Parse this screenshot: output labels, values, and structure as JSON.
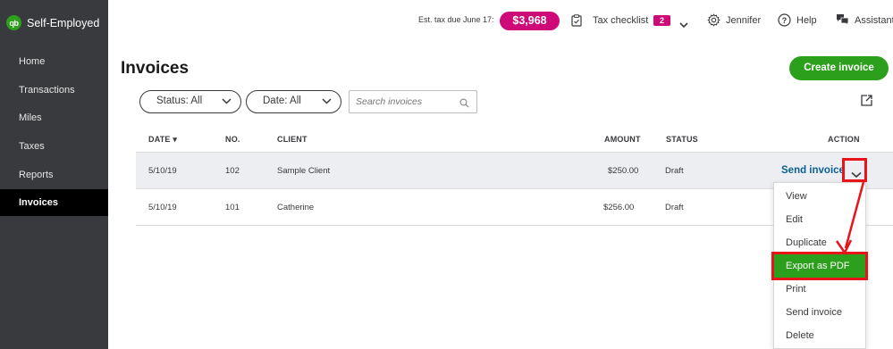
{
  "app": {
    "name": "Self-Employed",
    "logo_text": "qb"
  },
  "sidebar": {
    "items": [
      {
        "label": "Home",
        "active": false
      },
      {
        "label": "Transactions",
        "active": false
      },
      {
        "label": "Miles",
        "active": false
      },
      {
        "label": "Taxes",
        "active": false
      },
      {
        "label": "Reports",
        "active": false
      },
      {
        "label": "Invoices",
        "active": true
      }
    ]
  },
  "topbar": {
    "tax_due_label": "Est. tax due June 17:",
    "tax_due_amount": "$3,968",
    "checklist_label": "Tax checklist",
    "checklist_count": "2",
    "user_name": "Jennifer",
    "help_label": "Help",
    "assistant_label": "Assistant"
  },
  "page": {
    "title": "Invoices",
    "create_button": "Create invoice"
  },
  "filters": {
    "status_label": "Status: All",
    "date_label": "Date: All",
    "search_placeholder": "Search invoices"
  },
  "table": {
    "columns": {
      "date": "DATE ▾",
      "no": "NO.",
      "client": "CLIENT",
      "amount": "AMOUNT",
      "status": "STATUS",
      "action": "ACTION"
    },
    "rows": [
      {
        "date": "5/10/19",
        "no": "102",
        "client": "Sample Client",
        "amount": "$250.00",
        "status": "Draft",
        "action": "Send invoice"
      },
      {
        "date": "5/10/19",
        "no": "101",
        "client": "Catherine",
        "amount": "$256.00",
        "status": "Draft"
      }
    ]
  },
  "action_menu": {
    "items": [
      "View",
      "Edit",
      "Duplicate",
      "Export as PDF",
      "Print",
      "Send invoice",
      "Delete"
    ],
    "highlighted": "Export as PDF"
  },
  "colors": {
    "sidebar": "#393a3d",
    "brand_green": "#2ca01c",
    "badge_pink": "#cd0a77",
    "link_blue": "#0d6194",
    "annotation_red": "#e8141a"
  }
}
